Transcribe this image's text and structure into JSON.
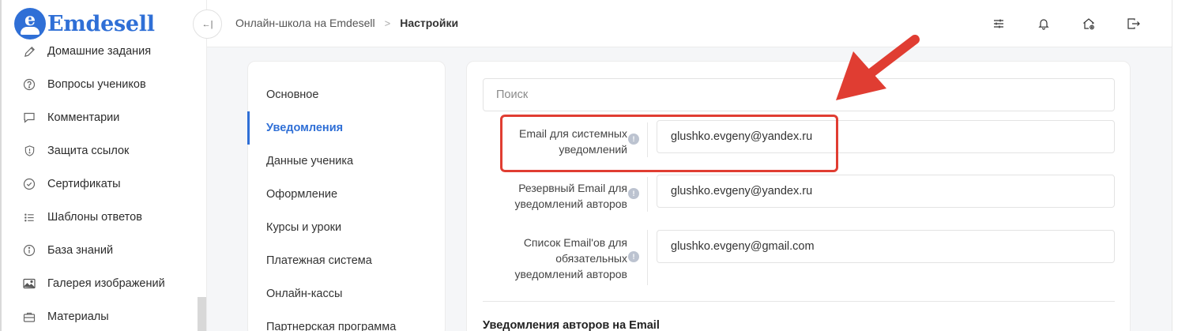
{
  "app": {
    "logo_letter": "e",
    "logo_text": "Emdesell",
    "brand_color": "#2f6fd6",
    "annotation_color": "#e03d32"
  },
  "sidebar": {
    "items": [
      {
        "label": "Домашние задания",
        "icon": "pencil-icon"
      },
      {
        "label": "Вопросы учеников",
        "icon": "question-circle-icon"
      },
      {
        "label": "Комментарии",
        "icon": "comment-icon"
      },
      {
        "label": "Защита ссылок",
        "icon": "shield-icon"
      },
      {
        "label": "Сертификаты",
        "icon": "check-badge-icon"
      },
      {
        "label": "Шаблоны ответов",
        "icon": "list-icon"
      },
      {
        "label": "База знаний",
        "icon": "info-circle-icon"
      },
      {
        "label": "Галерея изображений",
        "icon": "image-icon"
      },
      {
        "label": "Материалы",
        "icon": "briefcase-icon"
      }
    ]
  },
  "header": {
    "breadcrumb_parent": "Онлайн-школа на Emdesell",
    "breadcrumb_separator": ">",
    "breadcrumb_current": "Настройки",
    "collapse_glyph": "←|",
    "icons": [
      "sliders-icon",
      "bell-icon",
      "home-settings-icon",
      "logout-icon"
    ]
  },
  "settings_nav": {
    "items": [
      {
        "label": "Основное",
        "active": false
      },
      {
        "label": "Уведомления",
        "active": true
      },
      {
        "label": "Данные ученика",
        "active": false
      },
      {
        "label": "Оформление",
        "active": false
      },
      {
        "label": "Курсы и уроки",
        "active": false
      },
      {
        "label": "Платежная система",
        "active": false
      },
      {
        "label": "Онлайн-кассы",
        "active": false
      },
      {
        "label": "Партнерская программа",
        "active": false
      }
    ]
  },
  "main": {
    "search_placeholder": "Поиск",
    "fields": [
      {
        "label_lines": [
          "Email для системных",
          "уведомлений"
        ],
        "value": "glushko.evgeny@yandex.ru"
      },
      {
        "label_lines": [
          "Резервный Email для",
          "уведомлений авторов"
        ],
        "value": "glushko.evgeny@yandex.ru"
      },
      {
        "label_lines": [
          "Список Email'ов для",
          "обязательных",
          "уведомлений авторов"
        ],
        "value": "glushko.evgeny@gmail.com"
      }
    ],
    "info_glyph": "!",
    "section_title": "Уведомления авторов на Email"
  }
}
